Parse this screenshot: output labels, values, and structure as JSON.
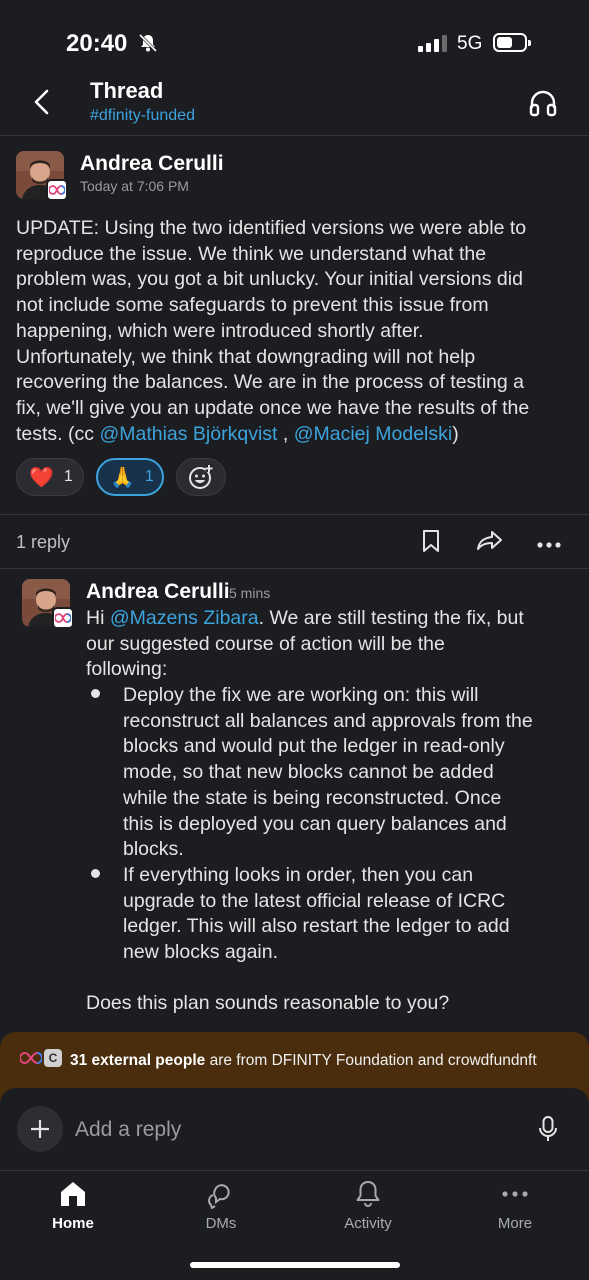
{
  "status": {
    "time": "20:40",
    "network": "5G"
  },
  "header": {
    "title": "Thread",
    "channel": "#dfinity-funded"
  },
  "message": {
    "author": "Andrea Cerulli",
    "time": "Today at 7:06 PM",
    "lines": [
      "UPDATE: Using the two identified versions we were able to",
      "reproduce the issue. We think we understand what the",
      "problem was, you got a bit unlucky. Your initial versions did",
      "not include some safeguards to prevent this issue from",
      "happening, which were introduced shortly after.",
      "Unfortunately, we think that downgrading will not help",
      "recovering the balances. We are in the process of testing a",
      "fix, we'll give you an update once we have the results of the"
    ],
    "last_line_prefix": "tests. (cc ",
    "mention1": "@Mathias Björkqvist",
    "separator": " , ",
    "mention2": "@Maciej Modelski",
    "last_line_suffix": ")"
  },
  "reactions": [
    {
      "emoji": "❤️",
      "icon": "heart-emoji",
      "count": "1"
    },
    {
      "emoji": "🙏",
      "icon": "folded-hands-emoji",
      "count": "1"
    }
  ],
  "thread": {
    "reply_count": "1 reply"
  },
  "reply": {
    "author": "Andrea Cerulli",
    "time": "5 mins",
    "line1_prefix": "Hi ",
    "mention": "@Mazens Zibara",
    "line1_suffix": ". We are still testing the fix, but",
    "intro_lines": [
      "our suggested course of action will be the",
      "following:"
    ],
    "bullet1": [
      "Deploy the fix we are working on: this will",
      "reconstruct all balances and approvals from the",
      "blocks and would put the ledger in read-only",
      "mode, so that new blocks cannot be added",
      "while the state is being reconstructed. Once",
      "this is deployed you can query balances and",
      "blocks."
    ],
    "bullet2": [
      "If everything looks in order, then you can",
      "upgrade to the latest official release of ICRC",
      "ledger. This will also restart the ledger to add",
      "new blocks again."
    ],
    "closing": "Does this plan sounds reasonable to you?"
  },
  "external_banner": {
    "badge_letter": "C",
    "count_text": "31 external people",
    "rest_text": " are from DFINITY Foundation and crowdfundnft"
  },
  "composer": {
    "placeholder": "Add a reply"
  },
  "tabs": [
    {
      "label": "Home"
    },
    {
      "label": "DMs"
    },
    {
      "label": "Activity"
    },
    {
      "label": "More"
    }
  ],
  "colors": {
    "accent": "#3da3dd",
    "background": "#1b1d21",
    "banner": "#4a2d0c"
  }
}
